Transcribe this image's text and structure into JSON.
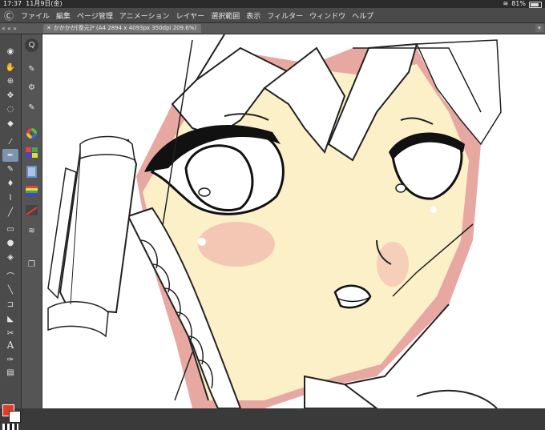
{
  "status": {
    "time": "17:37",
    "date": "11月9日(金)",
    "battery": "81%",
    "battery_level": 0.81
  },
  "menu": {
    "items": [
      "ファイル",
      "編集",
      "ページ管理",
      "アニメーション",
      "レイヤー",
      "選択範囲",
      "表示",
      "フィルター",
      "ウィンドウ",
      "ヘルプ"
    ]
  },
  "document": {
    "tab_title": "かかかか[復元]* (A4 2894 x 4093px 350dpi 209.6%)"
  },
  "tools": {
    "icons": [
      "compass-icon",
      "hand-icon",
      "zoom-icon",
      "move-icon",
      "lasso-icon",
      "operation-icon",
      "eyedropper-icon",
      "pen-icon",
      "pencil-icon",
      "brush-icon",
      "airbrush-icon",
      "blend-icon",
      "eraser-icon",
      "fill-icon",
      "gradient-icon",
      "figure-icon",
      "frame-icon",
      "ruler-icon",
      "text-icon",
      "balloon-icon",
      "correct-line-icon"
    ]
  },
  "colors": {
    "foreground": "#e43a28",
    "background": "#ffffff",
    "skin": "#fbf0c8",
    "shadow": "#e8a8a2",
    "blush": "#f2c0b0"
  }
}
